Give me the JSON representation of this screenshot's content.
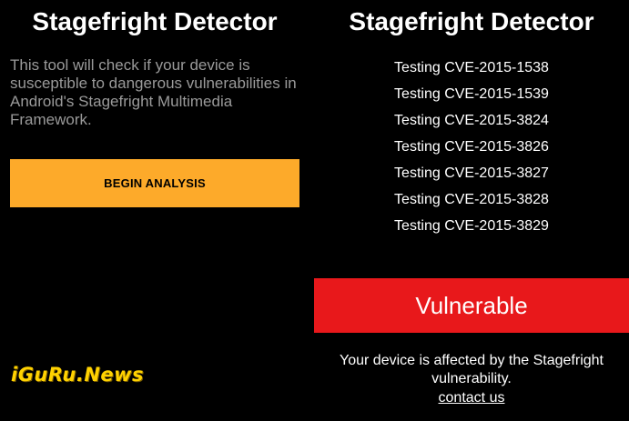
{
  "left_screen": {
    "title": "Stagefright Detector",
    "description": "This tool will check if your device is susceptible to dangerous vulnerabilities in Android's Stagefright Multimedia Framework.",
    "begin_button_label": "BEGIN ANALYSIS",
    "watermark": "iGuRu.News"
  },
  "right_screen": {
    "title": "Stagefright Detector",
    "tests": [
      "Testing CVE-2015-1538",
      "Testing CVE-2015-1539",
      "Testing CVE-2015-3824",
      "Testing CVE-2015-3826",
      "Testing CVE-2015-3827",
      "Testing CVE-2015-3828",
      "Testing CVE-2015-3829"
    ],
    "result_label": "Vulnerable",
    "result_message": "Your device is affected by the Stagefright vulnerability.",
    "contact_link": "contact us"
  },
  "colors": {
    "background": "#000000",
    "accent_button": "#fdaa2a",
    "vulnerable_red": "#e8181b",
    "description_gray": "#9a9a9a",
    "watermark_yellow": "#ffd200"
  }
}
